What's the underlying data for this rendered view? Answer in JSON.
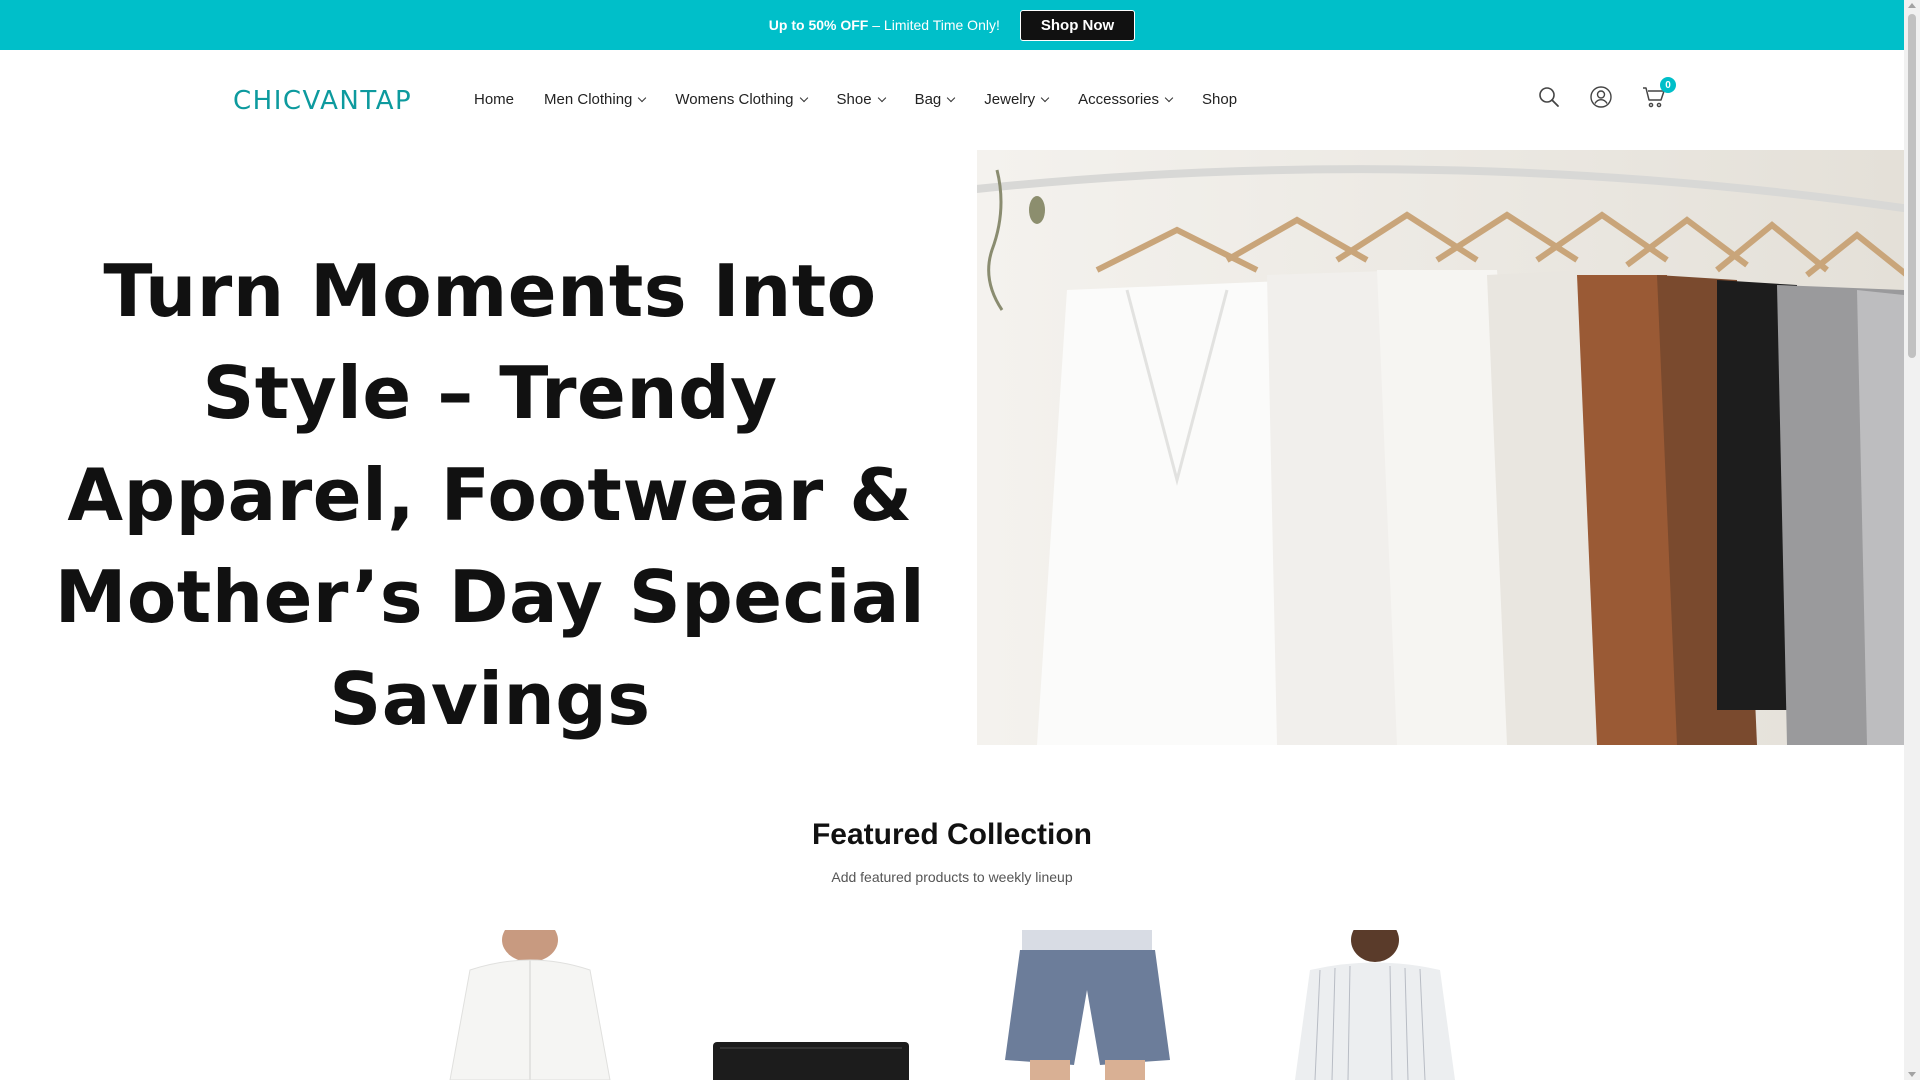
{
  "announcement": {
    "promo_bold": "Up to 50% OFF",
    "promo_rest": " – Limited Time Only!",
    "button": "Shop Now",
    "bg_color": "#00bfc9"
  },
  "header": {
    "logo": "CHICVANTAP",
    "nav": [
      {
        "label": "Home",
        "dropdown": false
      },
      {
        "label": "Men Clothing",
        "dropdown": true
      },
      {
        "label": "Womens Clothing",
        "dropdown": true
      },
      {
        "label": "Shoe",
        "dropdown": true
      },
      {
        "label": "Bag",
        "dropdown": true
      },
      {
        "label": "Jewelry",
        "dropdown": true
      },
      {
        "label": "Accessories",
        "dropdown": true
      },
      {
        "label": "Shop",
        "dropdown": false
      }
    ],
    "icons": [
      "search-icon",
      "account-icon",
      "cart-icon"
    ],
    "cart_count": "0"
  },
  "hero": {
    "headline": "Turn Moments Into Style – Trendy Apparel, Footwear & Mother’s Day Special Savings",
    "image": "clothes-rack-image"
  },
  "featured": {
    "title": "Featured Collection",
    "subtitle": "Add featured products to weekly lineup",
    "products": [
      {
        "image": "white-shirt-product-image"
      },
      {
        "image": "black-wallet-product-image"
      },
      {
        "image": "blue-shorts-product-image"
      },
      {
        "image": "striped-shirt-product-image"
      }
    ]
  }
}
